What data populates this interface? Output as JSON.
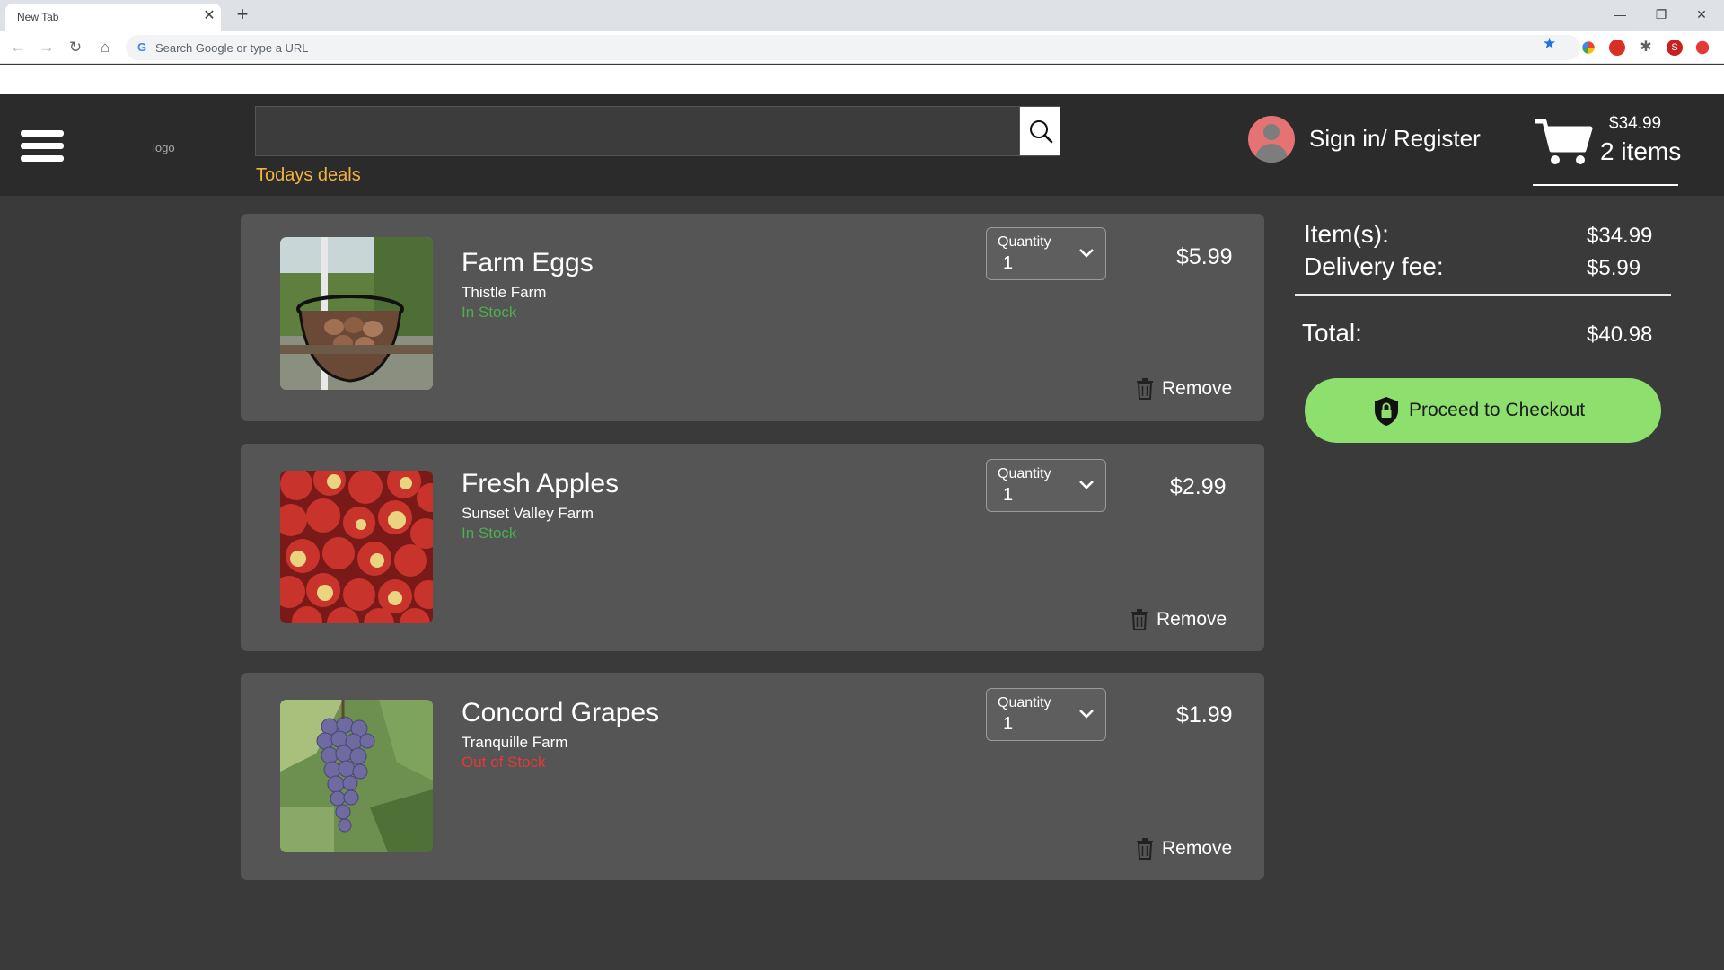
{
  "browser": {
    "tab_title": "New Tab",
    "tab_close": "✕",
    "new_tab": "+",
    "omnibox_placeholder": "Search Google or type a URL",
    "window_controls": {
      "minimize": "—",
      "restore": "❐",
      "close": "✕"
    }
  },
  "header": {
    "logo": "logo",
    "search_value": "",
    "deals_link": "Todays deals",
    "signin": "Sign in/ Register",
    "cart": {
      "total": "$34.99",
      "count": "2 items"
    }
  },
  "cart_items": [
    {
      "name": "Farm Eggs",
      "farm": "Thistle Farm",
      "stock": "In Stock",
      "stock_color": "#4caf50",
      "quantity_label": "Quantity",
      "quantity": "1",
      "price": "$5.99",
      "remove": "Remove"
    },
    {
      "name": "Fresh Apples",
      "farm": "Sunset Valley Farm",
      "stock": "In Stock",
      "stock_color": "#4caf50",
      "quantity_label": "Quantity",
      "quantity": "1",
      "price": "$2.99",
      "remove": "Remove"
    },
    {
      "name": "Concord Grapes",
      "farm": "Tranquille Farm",
      "stock": "Out of Stock",
      "stock_color": "#e53935",
      "quantity_label": "Quantity",
      "quantity": "1",
      "price": "$1.99",
      "remove": "Remove"
    }
  ],
  "summary": {
    "items_label": "Item(s):",
    "items_value": "$34.99",
    "delivery_label": "Delivery fee:",
    "delivery_value": "$5.99",
    "total_label": "Total:",
    "total_value": "$40.98",
    "checkout": "Proceed to Checkout"
  },
  "colors": {
    "header_bg": "#2b2b2b",
    "page_bg": "#3a3a3a",
    "card_bg": "#555555",
    "accent_deals": "#f2b640",
    "checkout_green": "#8ee06e"
  }
}
